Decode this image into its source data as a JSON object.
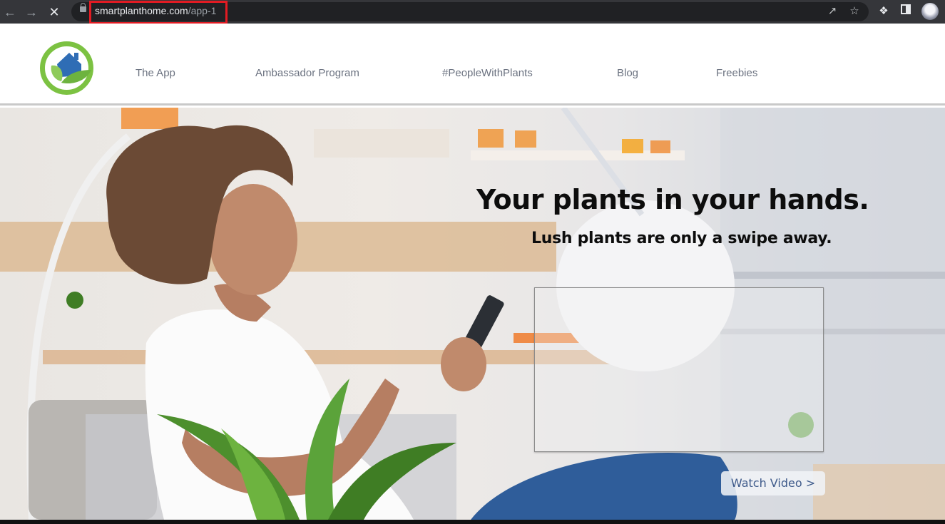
{
  "browser": {
    "url_domain": "smartplanthome.com",
    "url_path": "/app-1",
    "icons": [
      "back-arrow-icon",
      "forward-arrow-icon",
      "stop-loading-icon",
      "lock-icon",
      "share-icon",
      "bookmark-star-icon",
      "extensions-puzzle-icon",
      "side-panel-icon",
      "profile-avatar"
    ]
  },
  "header": {
    "logo_alt": "Smart Plant Home logo",
    "nav": [
      {
        "label": "The App"
      },
      {
        "label": "Ambassador Program"
      },
      {
        "label": "#PeopleWithPlants"
      },
      {
        "label": "Blog"
      },
      {
        "label": "Freebies"
      }
    ]
  },
  "hero": {
    "headline": "Your plants in your hands.",
    "subheadline": "Lush plants are only a swipe away.",
    "watch_button": "Watch Video >",
    "image_description": "Woman sitting on a sofa looking at a smartphone in a bright kitchen, plant in the foreground"
  },
  "colors": {
    "chrome_bg": "#35363a",
    "omnibox_bg": "#202124",
    "url_highlight": "#e21b23",
    "nav_text": "#6b7280",
    "logo_green": "#7cc242",
    "logo_blue": "#2f6db5",
    "button_text": "#3e5a8a"
  }
}
